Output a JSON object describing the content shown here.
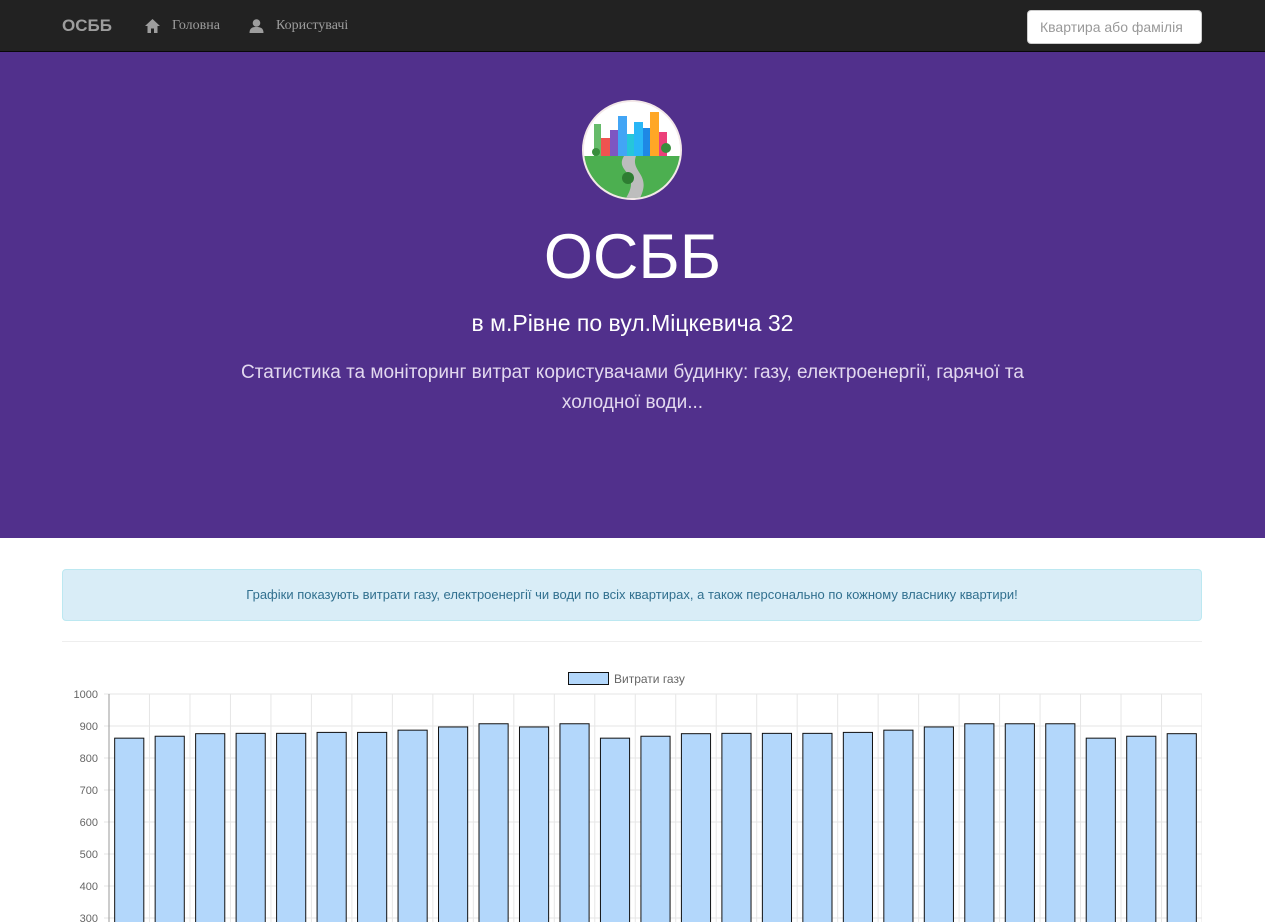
{
  "navbar": {
    "brand": "ОСББ",
    "items": [
      {
        "label": "Головна",
        "icon": "home-icon"
      },
      {
        "label": "Користувачі",
        "icon": "user-icon"
      }
    ],
    "search_placeholder": "Квартира або фамілія"
  },
  "hero": {
    "title": "ОСББ",
    "subtitle": "в м.Рівне по вул.Міцкевича 32",
    "description": "Статистика та моніторинг витрат користувачами будинку: газу, електроенергії, гарячої та холодної води...",
    "background_color": "#51308c"
  },
  "info_alert": "Графіки показують витрати газу, електроенергії чи води по всіх квартирах, а також персонально по кожному власнику квартири!",
  "chart_data": {
    "type": "bar",
    "series": [
      {
        "name": "Витрати газу",
        "values": [
          862,
          868,
          876,
          877,
          877,
          880,
          880,
          887,
          897,
          907,
          897,
          907,
          862,
          868,
          876,
          877,
          877,
          877,
          880,
          887,
          897,
          907,
          907,
          907,
          862,
          868,
          876
        ]
      }
    ],
    "y_ticks": [
      1000,
      900,
      800,
      700,
      600,
      500,
      400,
      300
    ],
    "ylim": [
      300,
      1000
    ],
    "legend_position": "top-center",
    "grid": true,
    "bar_fill": "#b3d7fb",
    "bar_stroke": "#111111"
  }
}
